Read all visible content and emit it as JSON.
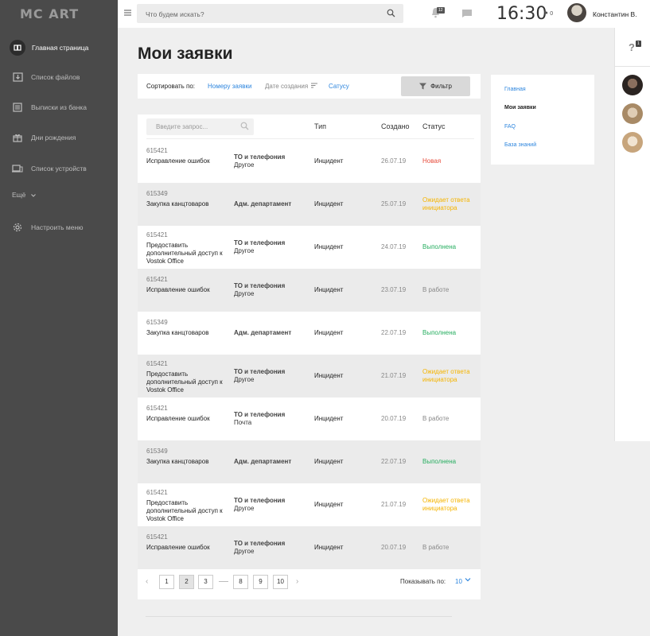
{
  "app": {
    "logo": "MC ART"
  },
  "sidebar": {
    "items": [
      {
        "label": "Главная страница",
        "icon": "home-icon"
      },
      {
        "label": "Список файлов",
        "icon": "download-icon"
      },
      {
        "label": "Выписки из банка",
        "icon": "document-list-icon"
      },
      {
        "label": "Дни рождения",
        "icon": "gift-icon"
      },
      {
        "label": "Список устройств",
        "icon": "devices-icon"
      }
    ],
    "more": "Ещё",
    "settings": "Настроить меню"
  },
  "topbar": {
    "search_placeholder": "Что будем искать?",
    "notifications_count": "12",
    "time": "16:30",
    "flag_count": "0",
    "user_name": "Константин В."
  },
  "rail": {
    "help_badge": "1"
  },
  "page": {
    "title": "Мои заявки"
  },
  "sort": {
    "label": "Сортировать по:",
    "by_number": "Номеру заявки",
    "by_date": "Дате создания",
    "by_status": "Сатусу",
    "filter_label": "Фильтр"
  },
  "table": {
    "search_placeholder": "Введите запрос...",
    "headers": {
      "type": "Тип",
      "created": "Создано",
      "status": "Статус"
    },
    "rows": [
      {
        "id": "615421",
        "name": "Исправление ошибок",
        "dept": "ТО и телефония",
        "dept_sub": "Другое",
        "type": "Инцидент",
        "date": "26.07.19",
        "status": "Новая",
        "status_color": "#e74c3c"
      },
      {
        "id": "615349",
        "name": "Закупка канцтоваров",
        "dept": "Адм. департамент",
        "dept_sub": "",
        "type": "Инцидент",
        "date": "25.07.19",
        "status": "Ожидает ответа инициатора",
        "status_color": "#f5b400"
      },
      {
        "id": "615421",
        "name": "Предоставить дополнительный доступ к Vostok Office",
        "dept": "ТО и телефония",
        "dept_sub": "Другое",
        "type": "Инцидент",
        "date": "24.07.19",
        "status": "Выполнена",
        "status_color": "#27ae60"
      },
      {
        "id": "615421",
        "name": "Исправление ошибок",
        "dept": "ТО и телефония",
        "dept_sub": "Другое",
        "type": "Инцидент",
        "date": "23.07.19",
        "status": "В работе",
        "status_color": "#888888"
      },
      {
        "id": "615349",
        "name": "Закупка канцтоваров",
        "dept": "Адм. департамент",
        "dept_sub": "",
        "type": "Инцидент",
        "date": "22.07.19",
        "status": "Выполнена",
        "status_color": "#27ae60"
      },
      {
        "id": "615421",
        "name": "Предоставить дополнительный доступ к Vostok Office",
        "dept": "ТО и телефония",
        "dept_sub": "Другое",
        "type": "Инцидент",
        "date": "21.07.19",
        "status": "Ожидает ответа инициатора",
        "status_color": "#f5b400"
      },
      {
        "id": "615421",
        "name": "Исправление ошибок",
        "dept": "ТО и телефония",
        "dept_sub": "Почта",
        "type": "Инцидент",
        "date": "20.07.19",
        "status": "В работе",
        "status_color": "#888888"
      },
      {
        "id": "615349",
        "name": "Закупка канцтоваров",
        "dept": "Адм. департамент",
        "dept_sub": "",
        "type": "Инцидент",
        "date": "22.07.19",
        "status": "Выполнена",
        "status_color": "#27ae60"
      },
      {
        "id": "615421",
        "name": "Предоставить дополнительный доступ к Vostok Office",
        "dept": "ТО и телефония",
        "dept_sub": "Другое",
        "type": "Инцидент",
        "date": "21.07.19",
        "status": "Ожидает ответа инициатора",
        "status_color": "#f5b400"
      },
      {
        "id": "615421",
        "name": "Исправление ошибок",
        "dept": "ТО и телефония",
        "dept_sub": "Другое",
        "type": "Инцидент",
        "date": "20.07.19",
        "status": "В работе",
        "status_color": "#888888"
      }
    ]
  },
  "pagination": {
    "pages": [
      "1",
      "2",
      "3",
      "8",
      "9",
      "10"
    ],
    "current": "2",
    "show_label": "Показывать по:",
    "show_value": "10"
  },
  "sidenav": {
    "items": [
      "Главная",
      "Мои заявки",
      "FAQ",
      "База знаний"
    ],
    "current": "Мои заявки"
  }
}
